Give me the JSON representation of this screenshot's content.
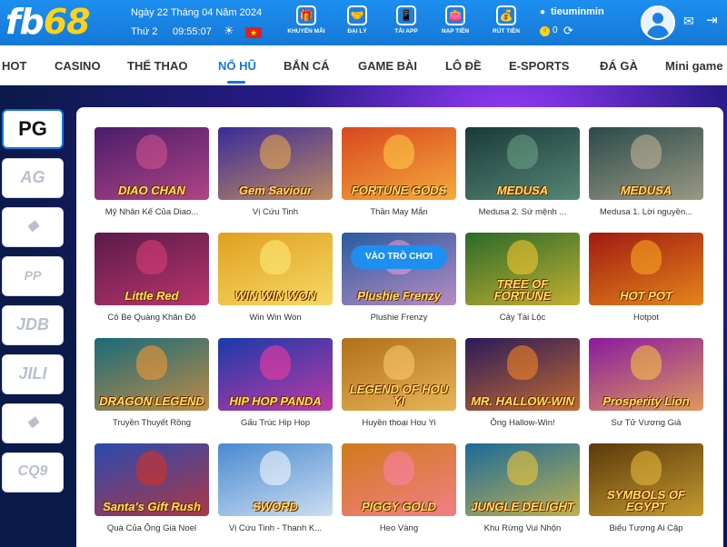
{
  "brand": {
    "part1": "fb",
    "part2": "68"
  },
  "header": {
    "date": "Ngày 22 Tháng 04 Năm 2024",
    "weekday": "Thứ 2",
    "time": "09:55:07",
    "flag_symbol": "★",
    "buttons": [
      {
        "label": "KHUYẾN MÃI",
        "icon": "gift-icon"
      },
      {
        "label": "ĐẠI LÝ",
        "icon": "handshake-icon"
      },
      {
        "label": "TẢI APP",
        "icon": "phone-icon"
      },
      {
        "label": "NẠP TIỀN",
        "icon": "wallet-icon"
      },
      {
        "label": "RÚT TIỀN",
        "icon": "money-bag-icon"
      }
    ],
    "username": "tieuminmin",
    "balance": "0"
  },
  "nav": {
    "items": [
      "HOT",
      "CASINO",
      "THỂ THAO",
      "NỔ HŨ",
      "BẮN CÁ",
      "GAME BÀI",
      "LÔ ĐỀ",
      "E-SPORTS",
      "ĐÁ GÀ",
      "Mini game"
    ],
    "active": "NỔ HŨ"
  },
  "providers": [
    "PG",
    "AG",
    "",
    "PP",
    "JDB",
    "JILI",
    "",
    "CQ9"
  ],
  "play_label": "VÀO TRÒ CHƠI",
  "games": [
    {
      "name": "Mỹ Nhân Kế Của Diao...",
      "art": "DIAO CHAN",
      "bg": "#4a1c6b",
      "accent": "#d9558f"
    },
    {
      "name": "Vị Cứu Tinh",
      "art": "Gem Saviour",
      "bg": "#3a2a9a",
      "accent": "#f2b24a"
    },
    {
      "name": "Thần May Mắn",
      "art": "FORTUNE GODS",
      "bg": "#d9471e",
      "accent": "#ffd34a"
    },
    {
      "name": "Medusa 2. Sứ mệnh ...",
      "art": "MEDUSA",
      "bg": "#1a3a3a",
      "accent": "#6fa58c"
    },
    {
      "name": "Medusa 1. Lời nguyền...",
      "art": "MEDUSA",
      "bg": "#2a4a4a",
      "accent": "#c8b89a"
    },
    {
      "name": "Cô Bé Quàng Khăn Đỏ",
      "art": "Little Red",
      "bg": "#5a1a4a",
      "accent": "#e0407a"
    },
    {
      "name": "Win Win Won",
      "art": "WIN WIN WON",
      "bg": "#e0a020",
      "accent": "#ffef80"
    },
    {
      "name": "Plushie Frenzy",
      "art": "Plushie Frenzy",
      "bg": "#2a5aa0",
      "accent": "#f0a0d0"
    },
    {
      "name": "Cây Tài Lộc",
      "art": "TREE OF FORTUNE",
      "bg": "#2a6a2a",
      "accent": "#ffcc33"
    },
    {
      "name": "Hotpot",
      "art": "HOT POT",
      "bg": "#a01a10",
      "accent": "#ffb020"
    },
    {
      "name": "Truyền Thuyết Rồng",
      "art": "DRAGON LEGEND",
      "bg": "#1a6a7a",
      "accent": "#ff9a30"
    },
    {
      "name": "Gấu Trúc Hip Hop",
      "art": "HIP HOP PANDA",
      "bg": "#1a3aaa",
      "accent": "#ff3aa0"
    },
    {
      "name": "Huyền thoại Hou Yi",
      "art": "LEGEND OF HOU YI",
      "bg": "#b0701a",
      "accent": "#ffd070"
    },
    {
      "name": "Ông Hallow-Win!",
      "art": "MR. HALLOW-WIN",
      "bg": "#2a1a5a",
      "accent": "#ff8a20"
    },
    {
      "name": "Sư Tử Vương Giả",
      "art": "Prosperity Lion",
      "bg": "#8a1aa0",
      "accent": "#ffcc40"
    },
    {
      "name": "Quà Của Ông Già Noel",
      "art": "Santa's Gift Rush",
      "bg": "#2a4ab0",
      "accent": "#e0301a"
    },
    {
      "name": "Vị Cứu Tinh - Thanh K...",
      "art": "SWORD",
      "bg": "#4a8ad0",
      "accent": "#ffffff"
    },
    {
      "name": "Heo Vàng",
      "art": "PIGGY GOLD",
      "bg": "#d07a1a",
      "accent": "#ff80b0"
    },
    {
      "name": "Khu Rừng Vui Nhộn",
      "art": "JUNGLE DELIGHT",
      "bg": "#1a6a9a",
      "accent": "#ffcc33"
    },
    {
      "name": "Biểu Tượng Ai Cập",
      "art": "SYMBOLS OF EGYPT",
      "bg": "#5a3a0a",
      "accent": "#f0c040"
    }
  ]
}
